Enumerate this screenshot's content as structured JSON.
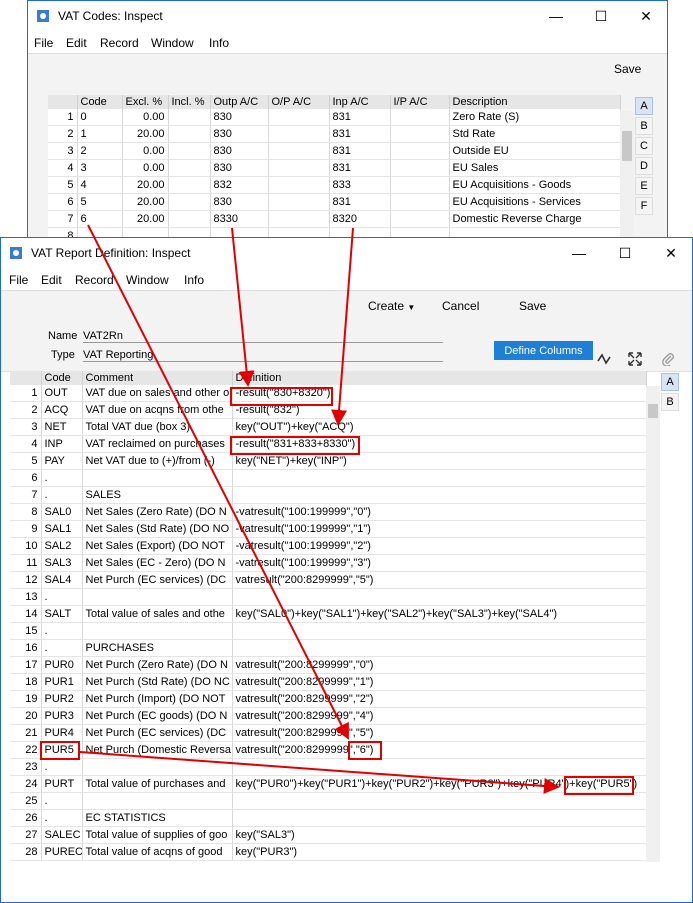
{
  "win1": {
    "title": "VAT Codes: Inspect",
    "menu": [
      "File",
      "Edit",
      "Record",
      "Window",
      "Info"
    ],
    "save_label": "Save",
    "columns": [
      "",
      "Code",
      "Excl. %",
      "Incl. %",
      "Outp A/C",
      "O/P A/C",
      "Inp A/C",
      "I/P A/C",
      "Description"
    ],
    "rows": [
      [
        "1",
        "0",
        "0.00",
        "",
        "830",
        "",
        "831",
        "",
        "Zero Rate (S)"
      ],
      [
        "2",
        "1",
        "20.00",
        "",
        "830",
        "",
        "831",
        "",
        "Std Rate"
      ],
      [
        "3",
        "2",
        "0.00",
        "",
        "830",
        "",
        "831",
        "",
        "Outside EU"
      ],
      [
        "4",
        "3",
        "0.00",
        "",
        "830",
        "",
        "831",
        "",
        "EU Sales"
      ],
      [
        "5",
        "4",
        "20.00",
        "",
        "832",
        "",
        "833",
        "",
        "EU Acquisitions - Goods"
      ],
      [
        "6",
        "5",
        "20.00",
        "",
        "830",
        "",
        "831",
        "",
        "EU Acquisitions - Services"
      ],
      [
        "7",
        "6",
        "20.00",
        "",
        "8330",
        "",
        "8320",
        "",
        "Domestic Reverse Charge"
      ],
      [
        "8",
        "",
        "",
        "",
        "",
        "",
        "",
        "",
        ""
      ]
    ],
    "tabs": [
      "A",
      "B",
      "C",
      "D",
      "E",
      "F"
    ]
  },
  "win2": {
    "title": "VAT Report Definition: Inspect",
    "menu": [
      "File",
      "Edit",
      "Record",
      "Window",
      "Info"
    ],
    "create_label": "Create",
    "cancel_label": "Cancel",
    "save_label": "Save",
    "name_label": "Name",
    "name_value": "VAT2Rn",
    "type_label": "Type",
    "type_value": "VAT Reporting",
    "define_columns_label": "Define Columns",
    "columns": [
      "",
      "Code",
      "Comment",
      "Definition"
    ],
    "rows": [
      [
        "1",
        "OUT",
        "VAT due on sales and other o",
        "-result(\"830+8320\")"
      ],
      [
        "2",
        "ACQ",
        "VAT due on acqns from othe",
        "-result(\"832\")"
      ],
      [
        "3",
        "NET",
        "Total VAT due (box 3)",
        "key(\"OUT\")+key(\"ACQ\")"
      ],
      [
        "4",
        "INP",
        "VAT reclaimed on purchases",
        "-result(\"831+833+8330\")"
      ],
      [
        "5",
        "PAY",
        "Net VAT due to (+)/from (-)",
        "key(\"NET\")+key(\"INP\")"
      ],
      [
        "6",
        ".",
        "",
        ""
      ],
      [
        "7",
        ".",
        "SALES",
        ""
      ],
      [
        "8",
        "SAL0",
        "Net Sales (Zero Rate)  (DO N",
        "-vatresult(\"100:199999\",\"0\")"
      ],
      [
        "9",
        "SAL1",
        "Net Sales (Std Rate)  (DO NO",
        "-vatresult(\"100:199999\",\"1\")"
      ],
      [
        "10",
        "SAL2",
        "Net Sales (Export)  (DO NOT",
        "-vatresult(\"100:199999\",\"2\")"
      ],
      [
        "11",
        "SAL3",
        "Net Sales (EC - Zero)  (DO N",
        "-vatresult(\"100:199999\",\"3\")"
      ],
      [
        "12",
        "SAL4",
        "Net Purch (EC services)  (DC",
        "vatresult(\"200:8299999\",\"5\")"
      ],
      [
        "13",
        ".",
        "",
        ""
      ],
      [
        "14",
        "SALT",
        "Total value of sales and othe",
        "key(\"SAL0\")+key(\"SAL1\")+key(\"SAL2\")+key(\"SAL3\")+key(\"SAL4\")"
      ],
      [
        "15",
        ".",
        "",
        ""
      ],
      [
        "16",
        ".",
        "PURCHASES",
        ""
      ],
      [
        "17",
        "PUR0",
        "Net Purch (Zero Rate)  (DO N",
        "vatresult(\"200:8299999\",\"0\")"
      ],
      [
        "18",
        "PUR1",
        "Net Purch (Std Rate)  (DO NC",
        "vatresult(\"200:8299999\",\"1\")"
      ],
      [
        "19",
        "PUR2",
        "Net Purch (Import)  (DO NOT",
        "vatresult(\"200:8299999\",\"2\")"
      ],
      [
        "20",
        "PUR3",
        "Net Purch (EC goods)  (DO N",
        "vatresult(\"200:8299999\",\"4\")"
      ],
      [
        "21",
        "PUR4",
        "Net Purch (EC services)  (DC",
        "vatresult(\"200:8299999\",\"5\")"
      ],
      [
        "22",
        "PUR5",
        "Net Purch (Domestic Reversa",
        "vatresult(\"200:8299999\",\"6\")"
      ],
      [
        "23",
        ".",
        "",
        ""
      ],
      [
        "24",
        "PURT",
        "Total value of purchases and",
        "key(\"PUR0\")+key(\"PUR1\")+key(\"PUR2\")+key(\"PUR3\")+key(\"PUR4\")+key(\"PUR5\")"
      ],
      [
        "25",
        ".",
        "",
        ""
      ],
      [
        "26",
        ".",
        "EC STATISTICS",
        ""
      ],
      [
        "27",
        "SALEC",
        "Total value of supplies of goo",
        "key(\"SAL3\")"
      ],
      [
        "28",
        "PUREC",
        "Total value of acqns of good",
        "key(\"PUR3\")"
      ]
    ],
    "tabs": [
      "A",
      "B"
    ]
  },
  "colors": {
    "window_border": "#1f6bd6",
    "button_blue": "#1e7fd6",
    "highlight_red": "#e00000",
    "header_gray": "#e6e6e6"
  }
}
